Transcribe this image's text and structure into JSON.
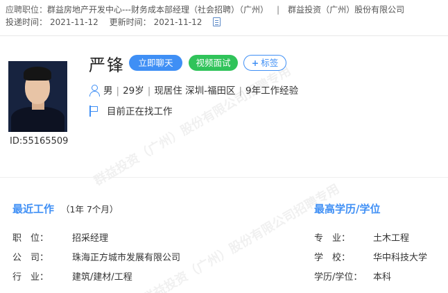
{
  "header": {
    "position_label": "应聘职位：",
    "position_value": "群益房地产开发中心---财务成本部经理（社会招聘）（广州）",
    "separator": "|",
    "company": "群益投资（广州）股份有限公司",
    "submit_label": "投递时间：",
    "submit_time": "2021-11-12",
    "update_label": "更新时间：",
    "update_time": "2021-11-12",
    "doc_icon": "document-icon"
  },
  "candidate": {
    "name": "严锋",
    "id_text": "ID:55165509",
    "gender": "男",
    "age": "29岁",
    "residence": "现居住 深圳-福田区",
    "experience": "9年工作经验",
    "job_status": "目前正在找工作"
  },
  "actions": {
    "chat_label": "立即聊天",
    "video_label": "视频面试",
    "tag_plus": "+",
    "tag_label": "标签"
  },
  "recent_work": {
    "title": "最近工作",
    "duration": "（1年 7个月）",
    "rows": [
      {
        "label": "职　位：",
        "value": "招采经理"
      },
      {
        "label": "公　司：",
        "value": "珠海正方城市发展有限公司"
      },
      {
        "label": "行　业：",
        "value": "建筑/建材/工程"
      }
    ]
  },
  "education": {
    "title": "最高学历/学位",
    "rows": [
      {
        "label": "专　业：",
        "value": "土木工程"
      },
      {
        "label": "学　校：",
        "value": "华中科技大学"
      },
      {
        "label": "学历/学位：",
        "value": "本科"
      }
    ]
  },
  "watermark": {
    "text1": "群益投资（广州）股份有限公司招聘专用",
    "text2": "群益投资（广州）股份有限公司招聘专用"
  },
  "colors": {
    "accent": "#3f8ff5",
    "video_green": "#30c35a"
  }
}
